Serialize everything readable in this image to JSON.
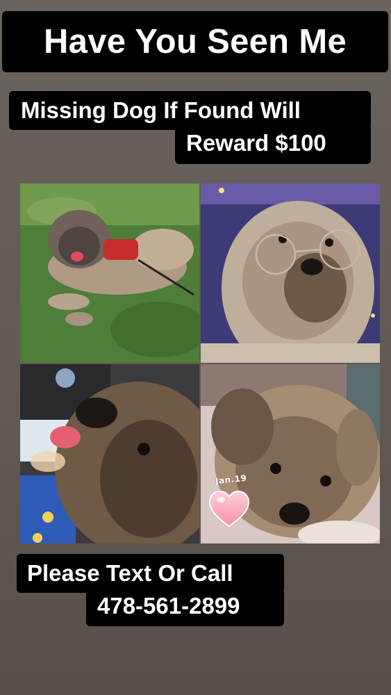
{
  "headline": "Have You Seen Me",
  "missing": {
    "line1": "Missing Dog If Found Will",
    "line2": "Reward $100"
  },
  "contact": {
    "line1": "Please Text Or Call",
    "phone": "478-561-2899"
  },
  "photos": [
    {
      "subject": "dog lying on grass wearing red harness"
    },
    {
      "subject": "dog wearing round glasses"
    },
    {
      "subject": "dog close-up with tongue out"
    },
    {
      "subject": "dog lying on blanket"
    }
  ],
  "sticker": {
    "date_text": "Jan.19",
    "icon": "heart-icon",
    "color": "#f6a8b8"
  }
}
